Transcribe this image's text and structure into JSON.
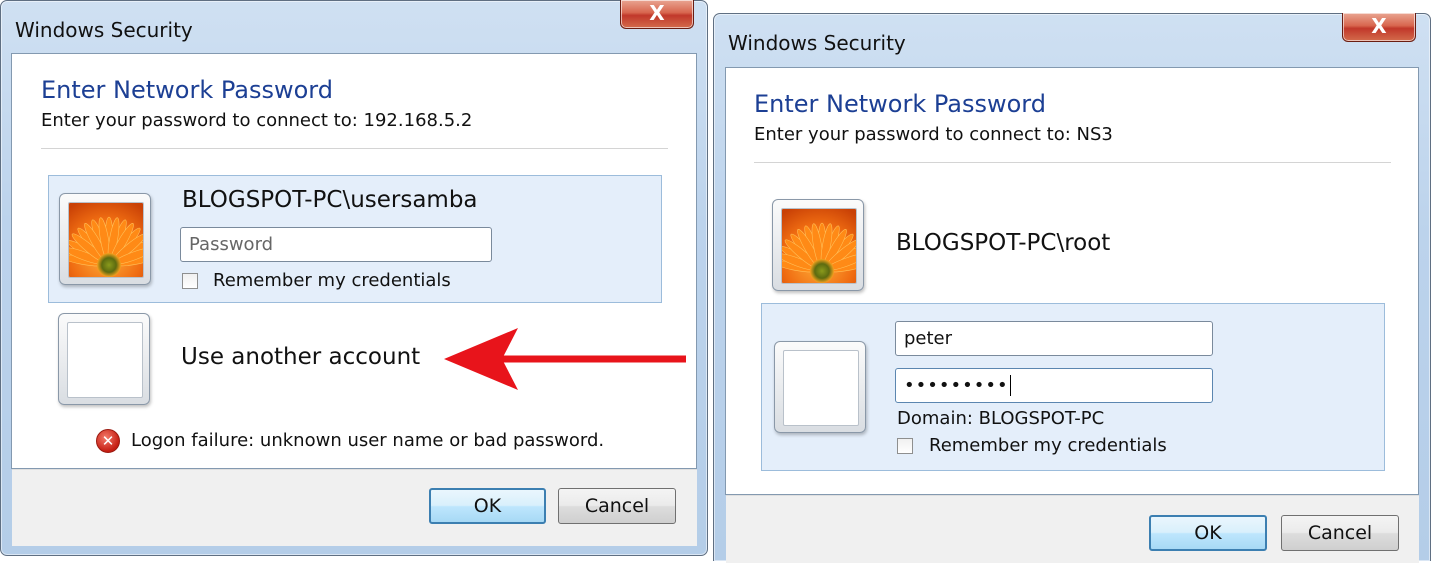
{
  "left_dialog": {
    "title": "Windows Security",
    "close_glyph": "X",
    "heading": "Enter Network Password",
    "subtitle": "Enter your password to connect to: 192.168.5.2",
    "account": {
      "name": "BLOGSPOT-PC\\usersamba",
      "password_placeholder": "Password",
      "remember_label": "Remember my credentials"
    },
    "other_account_label": "Use another account",
    "error_text": "Logon failure: unknown user name or bad password.",
    "ok_label": "OK",
    "cancel_label": "Cancel"
  },
  "right_dialog": {
    "title": "Windows Security",
    "close_glyph": "X",
    "heading": "Enter Network Password",
    "subtitle": "Enter your password to connect to: NS3",
    "account": {
      "name": "BLOGSPOT-PC\\root"
    },
    "other_account": {
      "username_value": "peter",
      "password_value": "•••••••••",
      "domain_text": "Domain: BLOGSPOT-PC",
      "remember_label": "Remember my credentials"
    },
    "ok_label": "OK",
    "cancel_label": "Cancel"
  },
  "annotation": {
    "arrow_color": "#e8141b"
  },
  "colors": {
    "heading": "#1c3f94",
    "tile_selected": "#e4eefa",
    "ok_border": "#3c7fb1",
    "close_button": "#c1382a"
  },
  "icons": {
    "close": "close-icon",
    "user_picture": "flower-avatar-icon",
    "error": "error-icon"
  }
}
